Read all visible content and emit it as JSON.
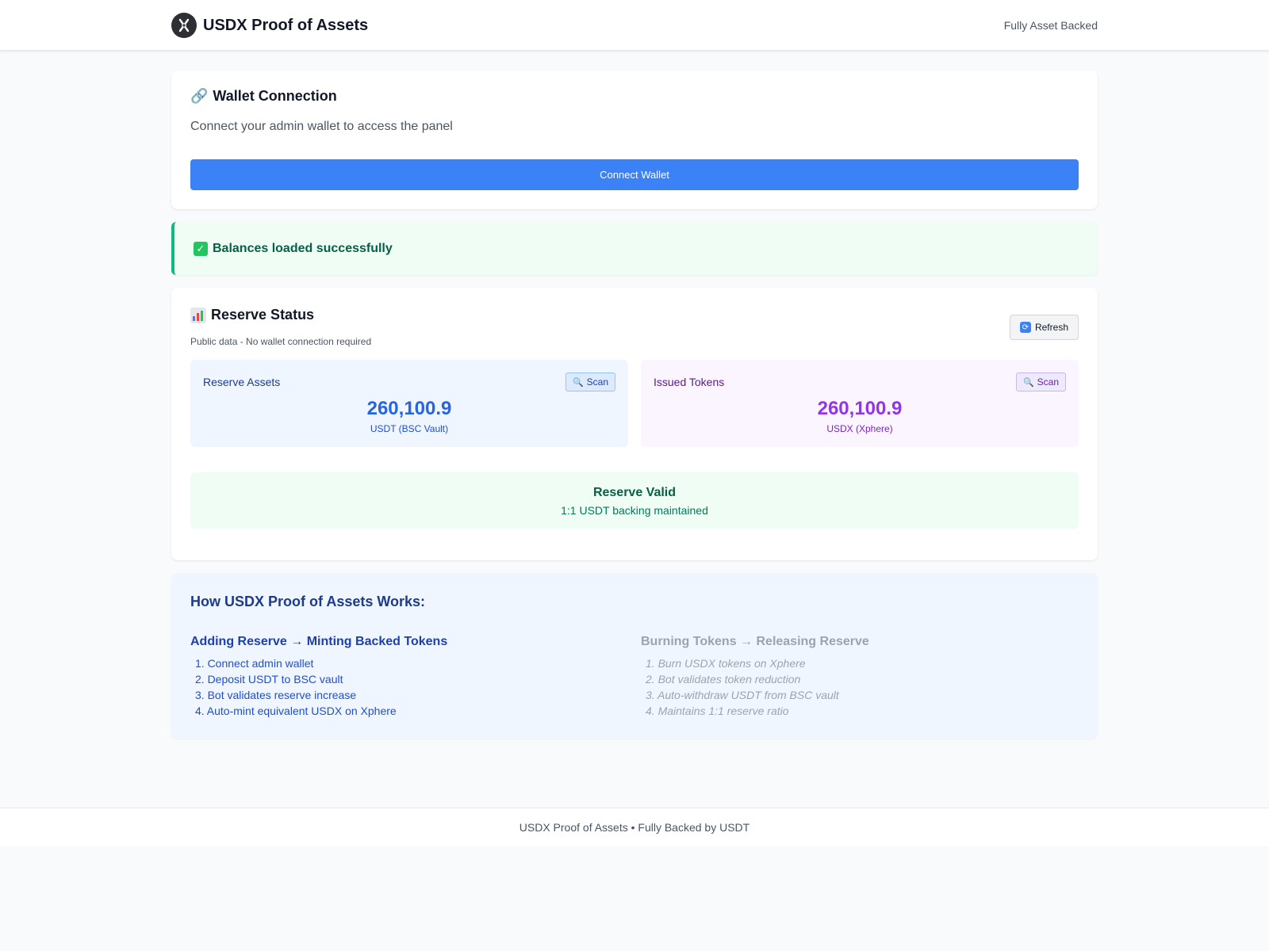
{
  "header": {
    "title": "USDX Proof of Assets",
    "tag": "Fully Asset Backed",
    "logo_icon": "usdx-logo-icon"
  },
  "wallet": {
    "title_icon": "🔗",
    "title": "Wallet Connection",
    "subtitle": "Connect your admin wallet to access the panel",
    "connect_label": "Connect Wallet"
  },
  "alert": {
    "icon": "✓",
    "text": "Balances loaded successfully"
  },
  "reserve": {
    "title": "Reserve Status",
    "subtitle": "Public data - No wallet connection required",
    "refresh_label": "Refresh",
    "assets": {
      "label": "Reserve Assets",
      "scan_label": "Scan",
      "value": "260,100.9",
      "unit": "USDT (BSC Vault)"
    },
    "issued": {
      "label": "Issued Tokens",
      "scan_label": "Scan",
      "value": "260,100.9",
      "unit": "USDX (Xphere)"
    },
    "valid": {
      "title": "Reserve Valid",
      "subtitle": "1:1 USDT backing maintained"
    }
  },
  "how": {
    "title": "How USDX Proof of Assets Works:",
    "minting": {
      "title": "Adding Reserve → Minting Backed Tokens",
      "steps": [
        "1. Connect admin wallet",
        "2. Deposit USDT to BSC vault",
        "3. Bot validates reserve increase",
        "4. Auto-mint equivalent USDX on Xphere"
      ]
    },
    "burning": {
      "title": "Burning Tokens → Releasing Reserve",
      "steps": [
        "1. Burn USDX tokens on Xphere",
        "2. Bot validates token reduction",
        "3. Auto-withdraw USDT from BSC vault",
        "4. Maintains 1:1 reserve ratio"
      ]
    }
  },
  "footer": {
    "text": "USDX Proof of Assets • Fully Backed by USDT"
  },
  "colors": {
    "accent": "#3b82f6",
    "success": "#10b981",
    "issued": "#9333ea"
  }
}
